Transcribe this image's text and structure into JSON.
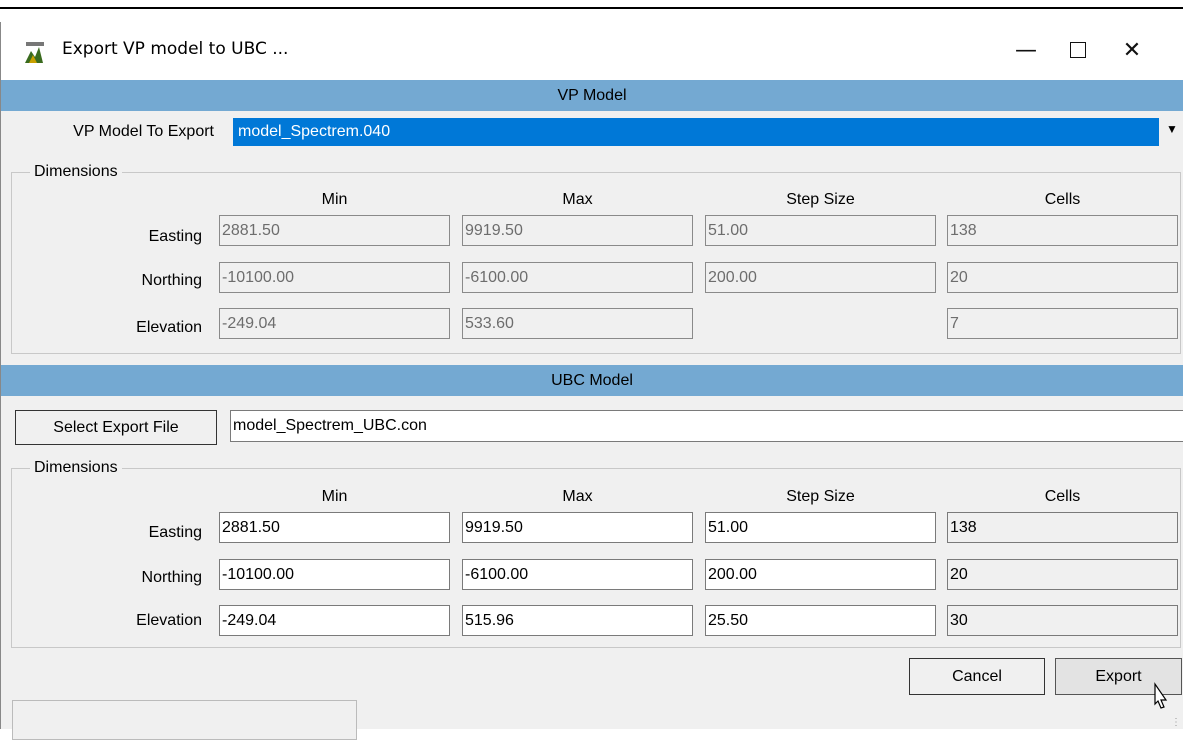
{
  "window": {
    "title": "Export VP model to UBC ...",
    "minimize_icon": "minimize-icon",
    "maximize_icon": "maximize-icon",
    "close_icon": "close-icon"
  },
  "vp_section": {
    "header": "VP Model",
    "model_label": "VP Model To Export",
    "model_value": "model_Spectrem.040",
    "dimensions_label": "Dimensions",
    "columns": [
      "Min",
      "Max",
      "Step Size",
      "Cells"
    ],
    "rows": [
      {
        "label": "Easting",
        "min": "2881.50",
        "max": "9919.50",
        "step": "51.00",
        "cells": "138"
      },
      {
        "label": "Northing",
        "min": "-10100.00",
        "max": "-6100.00",
        "step": "200.00",
        "cells": "20"
      },
      {
        "label": "Elevation",
        "min": "-249.04",
        "max": "533.60",
        "step": "",
        "cells": "7"
      }
    ]
  },
  "ubc_section": {
    "header": "UBC Model",
    "select_file_label": "Select Export File",
    "file_value": "model_Spectrem_UBC.con",
    "dimensions_label": "Dimensions",
    "columns": [
      "Min",
      "Max",
      "Step Size",
      "Cells"
    ],
    "rows": [
      {
        "label": "Easting",
        "min": "2881.50",
        "max": "9919.50",
        "step": "51.00",
        "cells": "138"
      },
      {
        "label": "Northing",
        "min": "-10100.00",
        "max": "-6100.00",
        "step": "200.00",
        "cells": "20"
      },
      {
        "label": "Elevation",
        "min": "-249.04",
        "max": "515.96",
        "step": "25.50",
        "cells": "30"
      }
    ]
  },
  "buttons": {
    "cancel": "Cancel",
    "export": "Export"
  },
  "colors": {
    "band": "#74a9d2",
    "selection": "#0078d7"
  }
}
